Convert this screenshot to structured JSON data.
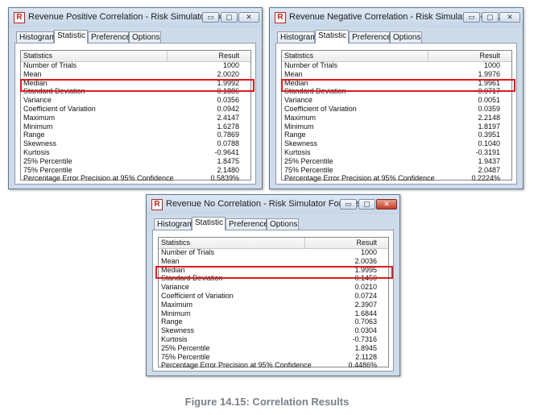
{
  "tabs": [
    "Histogram",
    "Statistic",
    "Preferences",
    "Options"
  ],
  "columns": {
    "label": "Statistics",
    "value": "Result"
  },
  "window_controls": {
    "minimize": "▭",
    "maximize": "▢",
    "close": "✕"
  },
  "stat_labels": [
    "Number of Trials",
    "Mean",
    "Median",
    "Standard Deviation",
    "Variance",
    "Coefficient of Variation",
    "Maximum",
    "Minimum",
    "Range",
    "Skewness",
    "Kurtosis",
    "25% Percentile",
    "75% Percentile",
    "Percentage Error Precision at 95% Confidence"
  ],
  "windows": [
    {
      "title": "Revenue Positive Correlation - Risk Simulator Forecast",
      "values": [
        "1000",
        "2.0020",
        "1.9992",
        "0.1886",
        "0.0356",
        "0.0942",
        "2.4147",
        "1.6278",
        "0.7869",
        "0.0788",
        "-0.9641",
        "1.8475",
        "2.1480",
        "0.5839%"
      ]
    },
    {
      "title": "Revenue Negative Correlation - Risk Simulator Forec...",
      "values": [
        "1000",
        "1.9976",
        "1.9961",
        "0.0717",
        "0.0051",
        "0.0359",
        "2.2148",
        "1.8197",
        "0.3951",
        "0.1040",
        "-0.3191",
        "1.9437",
        "2.0487",
        "0.2224%"
      ]
    },
    {
      "title": "Revenue No Correlation - Risk Simulator Forecast",
      "values": [
        "1000",
        "2.0036",
        "1.9995",
        "0.1450",
        "0.0210",
        "0.0724",
        "2.3907",
        "1.6844",
        "0.7063",
        "0.0304",
        "-0.7316",
        "1.8945",
        "2.1128",
        "0.4486%"
      ]
    }
  ],
  "caption": "Figure 14.15: Correlation Results",
  "colors": {
    "highlight": "#e01b1b",
    "caption": "#7b8088",
    "window_frame": "#cfdbe8"
  }
}
